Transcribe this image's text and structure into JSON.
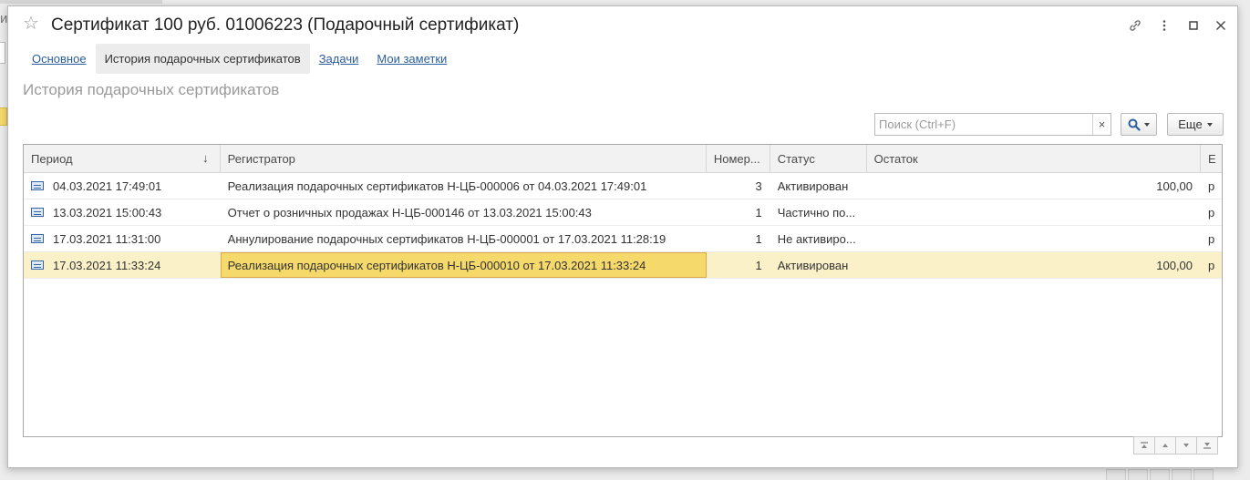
{
  "window": {
    "title": "Сертификат 100 руб. 01006223 (Подарочный сертификат)"
  },
  "background": {
    "left_text": "ин"
  },
  "tabs": [
    {
      "label": "Основное",
      "active": false
    },
    {
      "label": "История подарочных сертификатов",
      "active": true
    },
    {
      "label": "Задачи",
      "active": false
    },
    {
      "label": "Мои заметки",
      "active": false
    }
  ],
  "section": {
    "title": "История подарочных сертификатов"
  },
  "search": {
    "placeholder": "Поиск (Ctrl+F)",
    "value": "",
    "clear": "×"
  },
  "toolbar": {
    "more_label": "Еще"
  },
  "table": {
    "columns": [
      "Период",
      "Регистратор",
      "Номер...",
      "Статус",
      "Остаток",
      "Е"
    ],
    "sort_indicator": "↓",
    "rows": [
      {
        "period": "04.03.2021 17:49:01",
        "registrar": "Реализация подарочных сертификатов Н-ЦБ-000006 от 04.03.2021 17:49:01",
        "number": "3",
        "status": "Активирован",
        "rest": "100,00",
        "extra": "р",
        "selected": false
      },
      {
        "period": "13.03.2021 15:00:43",
        "registrar": "Отчет о розничных продажах Н-ЦБ-000146 от 13.03.2021 15:00:43",
        "number": "1",
        "status": "Частично по...",
        "rest": "",
        "extra": "р",
        "selected": false
      },
      {
        "period": "17.03.2021 11:31:00",
        "registrar": "Аннулирование подарочных сертификатов Н-ЦБ-000001 от 17.03.2021 11:28:19",
        "number": "1",
        "status": "Не активиро...",
        "rest": "",
        "extra": "р",
        "selected": false
      },
      {
        "period": "17.03.2021 11:33:24",
        "registrar": "Реализация подарочных сертификатов Н-ЦБ-000010 от 17.03.2021 11:33:24",
        "number": "1",
        "status": "Активирован",
        "rest": "100,00",
        "extra": "р",
        "selected": true
      }
    ]
  },
  "colors": {
    "accent_link": "#2c5d9e",
    "selection_row": "#fbf1c8",
    "selection_cell": "#f5d96b"
  }
}
